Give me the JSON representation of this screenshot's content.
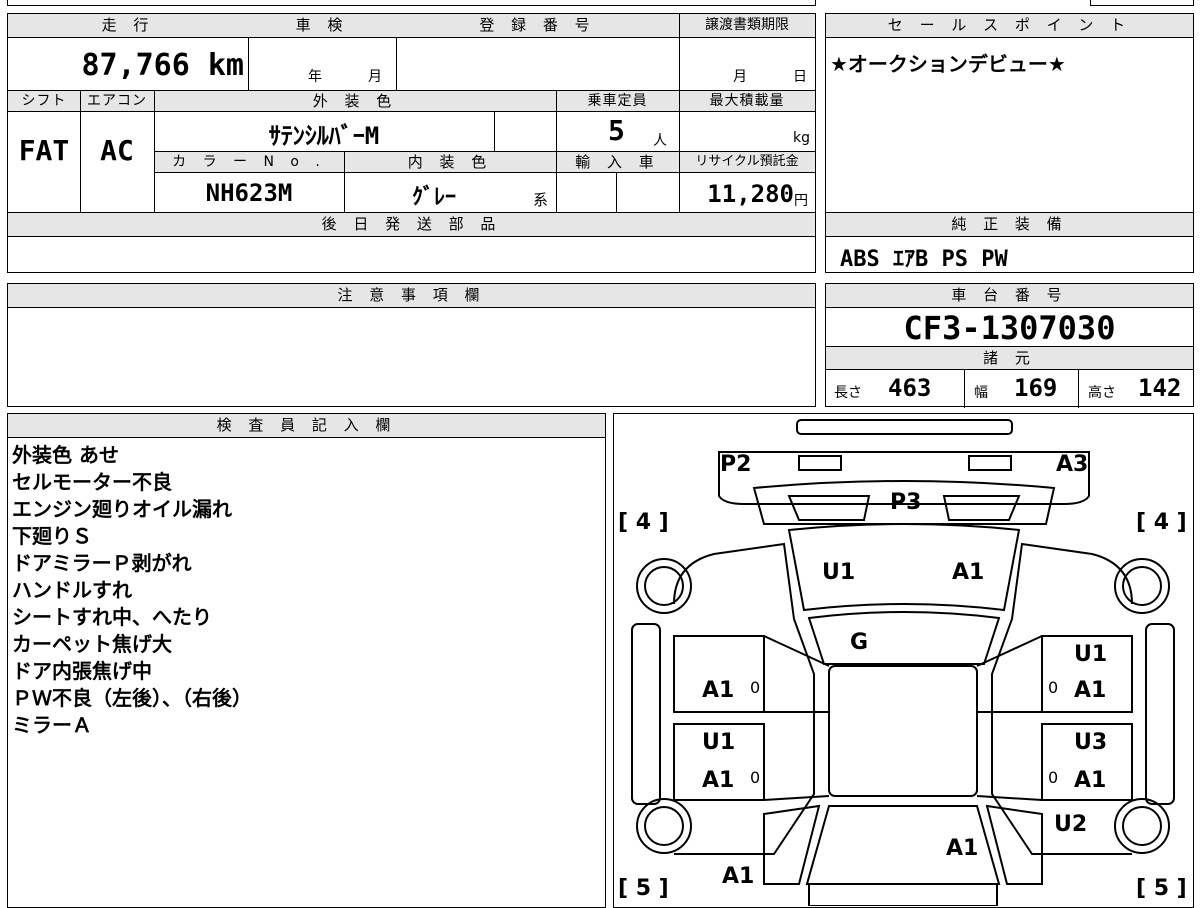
{
  "vehicle": {
    "mileage_header": "走 行",
    "mileage": "87,766 km",
    "shaken_header": "車 検",
    "shaken_year": "年",
    "shaken_month": "月",
    "reg_header": "登 録 番 号",
    "transfer_header": "譲渡書類期限",
    "transfer_month": "月",
    "transfer_day": "日",
    "shift_header": "シフト",
    "shift": "FAT",
    "ac_header": "エアコン",
    "ac": "AC",
    "exterior_header": "外 装 色",
    "exterior": "ｻﾃﾝｼﾙﾊﾞｰM",
    "capacity_header": "乗車定員",
    "capacity": "5",
    "capacity_unit": "人",
    "load_header": "最大積載量",
    "load_unit": "kg",
    "color_no_header": "カ ラ ー N o .",
    "color_no": "NH623M",
    "interior_header": "内 装 色",
    "interior": "ｸﾞﾚｰ",
    "interior_suffix": "系",
    "import_header": "輸 入 車",
    "recycle_header": "リサイクル預託金",
    "recycle": "11,280",
    "recycle_unit": "円",
    "later_parts_header": "後 日 発 送 部 品"
  },
  "sales": {
    "header": "セ ー ル ス ポ イ ン ト",
    "text": "★オークションデビュー★"
  },
  "equipment": {
    "header": "純 正 装 備",
    "text": "ABS ｴｱB PS PW"
  },
  "notes": {
    "header": "注 意 事 項 欄"
  },
  "chassis": {
    "header": "車 台 番 号",
    "number": "CF3-1307030",
    "spec_header": "諸 元",
    "length_label": "長さ",
    "length": "463",
    "width_label": "幅",
    "width": "169",
    "height_label": "高さ",
    "height": "142"
  },
  "inspector": {
    "header": "検 査 員 記 入 欄",
    "lines": [
      "外装色 あせ",
      "セルモーター不良",
      "エンジン廻りオイル漏れ",
      "下廻りＳ",
      "ドアミラーＰ剥がれ",
      "ハンドルすれ",
      "シートすれ中、へたり",
      "カーペット焦げ大",
      "ドア内張焦げ中",
      "ＰＷ不良（左後）、（右後）",
      "ミラーＡ"
    ]
  },
  "diagram": {
    "marks": {
      "p2": "P2",
      "a3": "A3",
      "p3": "P3",
      "tire_fl": "[ 4 ]",
      "tire_fr": "[ 4 ]",
      "hood_u1": "U1",
      "hood_a1": "A1",
      "g": "G",
      "rf_u1": "U1",
      "rf_a1": "A1",
      "rf_0": "0",
      "lf_a1": "A1",
      "lf_0": "0",
      "lr_u1": "U1",
      "lr_a1": "A1",
      "lr_0": "0",
      "rr_u3": "U3",
      "rr_a1": "A1",
      "rr_0": "0",
      "u2": "U2",
      "roof_a1": "A1",
      "rear_a1": "A1",
      "tire_rl": "[ 5 ]",
      "tire_rr": "[ 5 ]"
    }
  }
}
